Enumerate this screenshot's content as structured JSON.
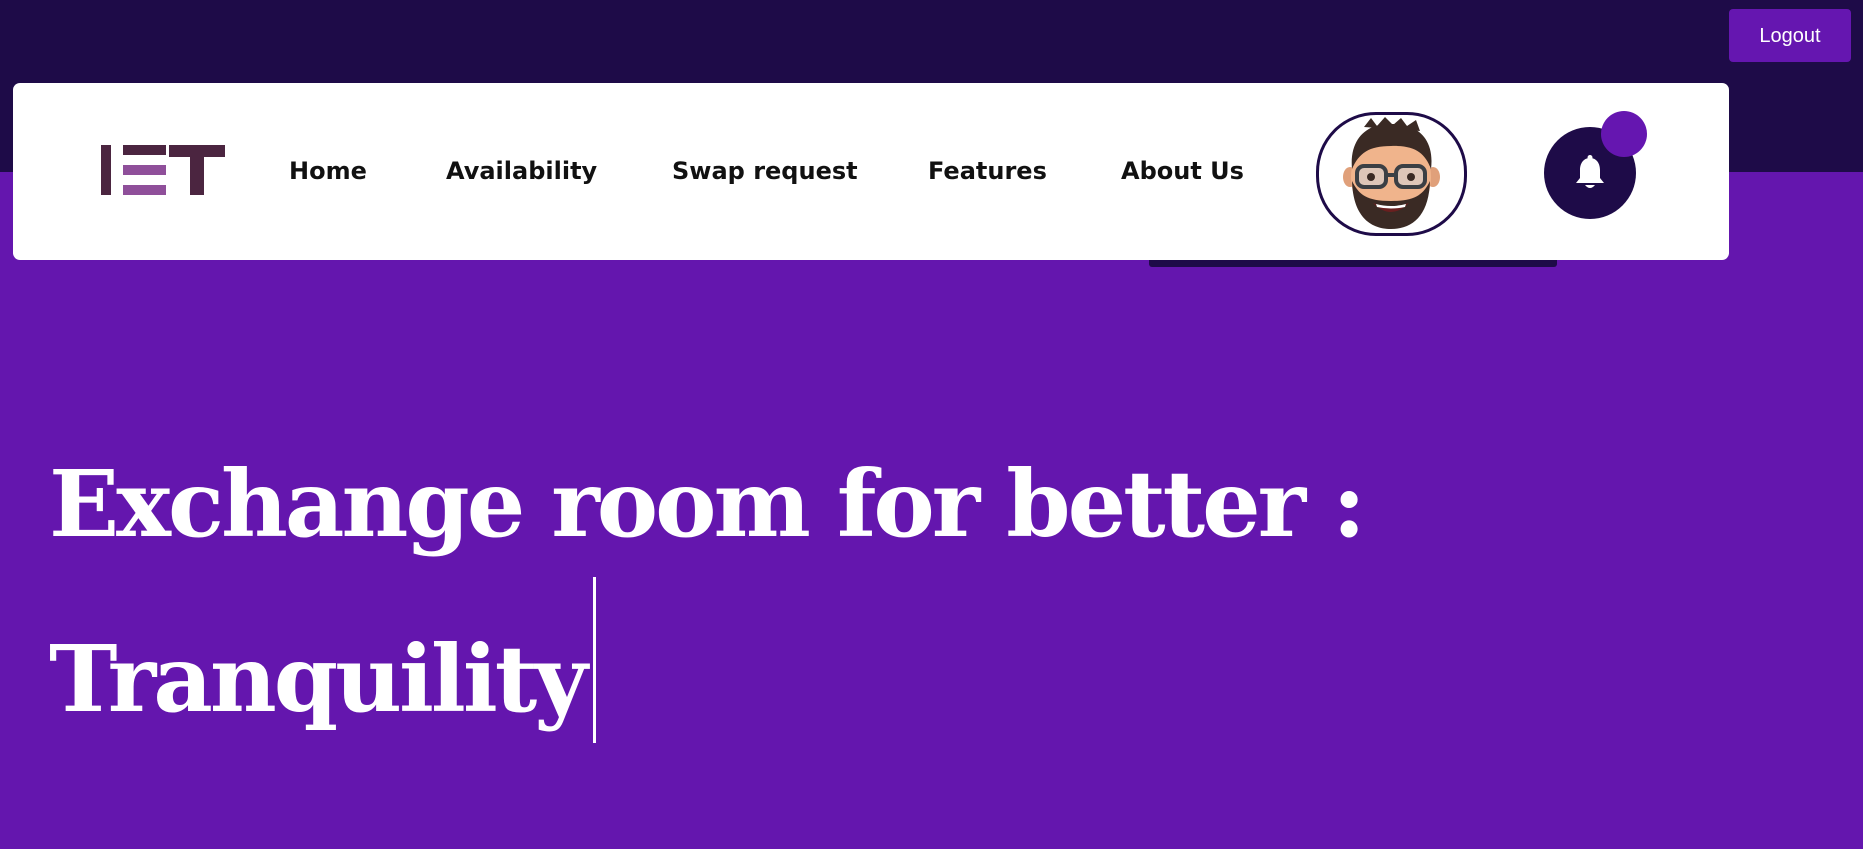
{
  "header": {
    "logout_label": "Logout"
  },
  "navbar": {
    "logo_text": "IET",
    "links": [
      {
        "label": "Home"
      },
      {
        "label": "Availability"
      },
      {
        "label": "Swap request"
      },
      {
        "label": "Features"
      },
      {
        "label": "About Us"
      }
    ],
    "avatar": "memoji-avatar",
    "notification_icon": "bell-icon"
  },
  "hero": {
    "line1": "Exchange room for better :",
    "line2": "Tranquility"
  },
  "colors": {
    "top_band": "#1e0b48",
    "hero_background": "#6416ae",
    "accent": "#6516b0",
    "navbar_background": "#ffffff",
    "text_dark": "#111111",
    "hero_text": "#ffffff",
    "logo_dark": "#4b2540",
    "logo_light": "#8f4f9a"
  }
}
